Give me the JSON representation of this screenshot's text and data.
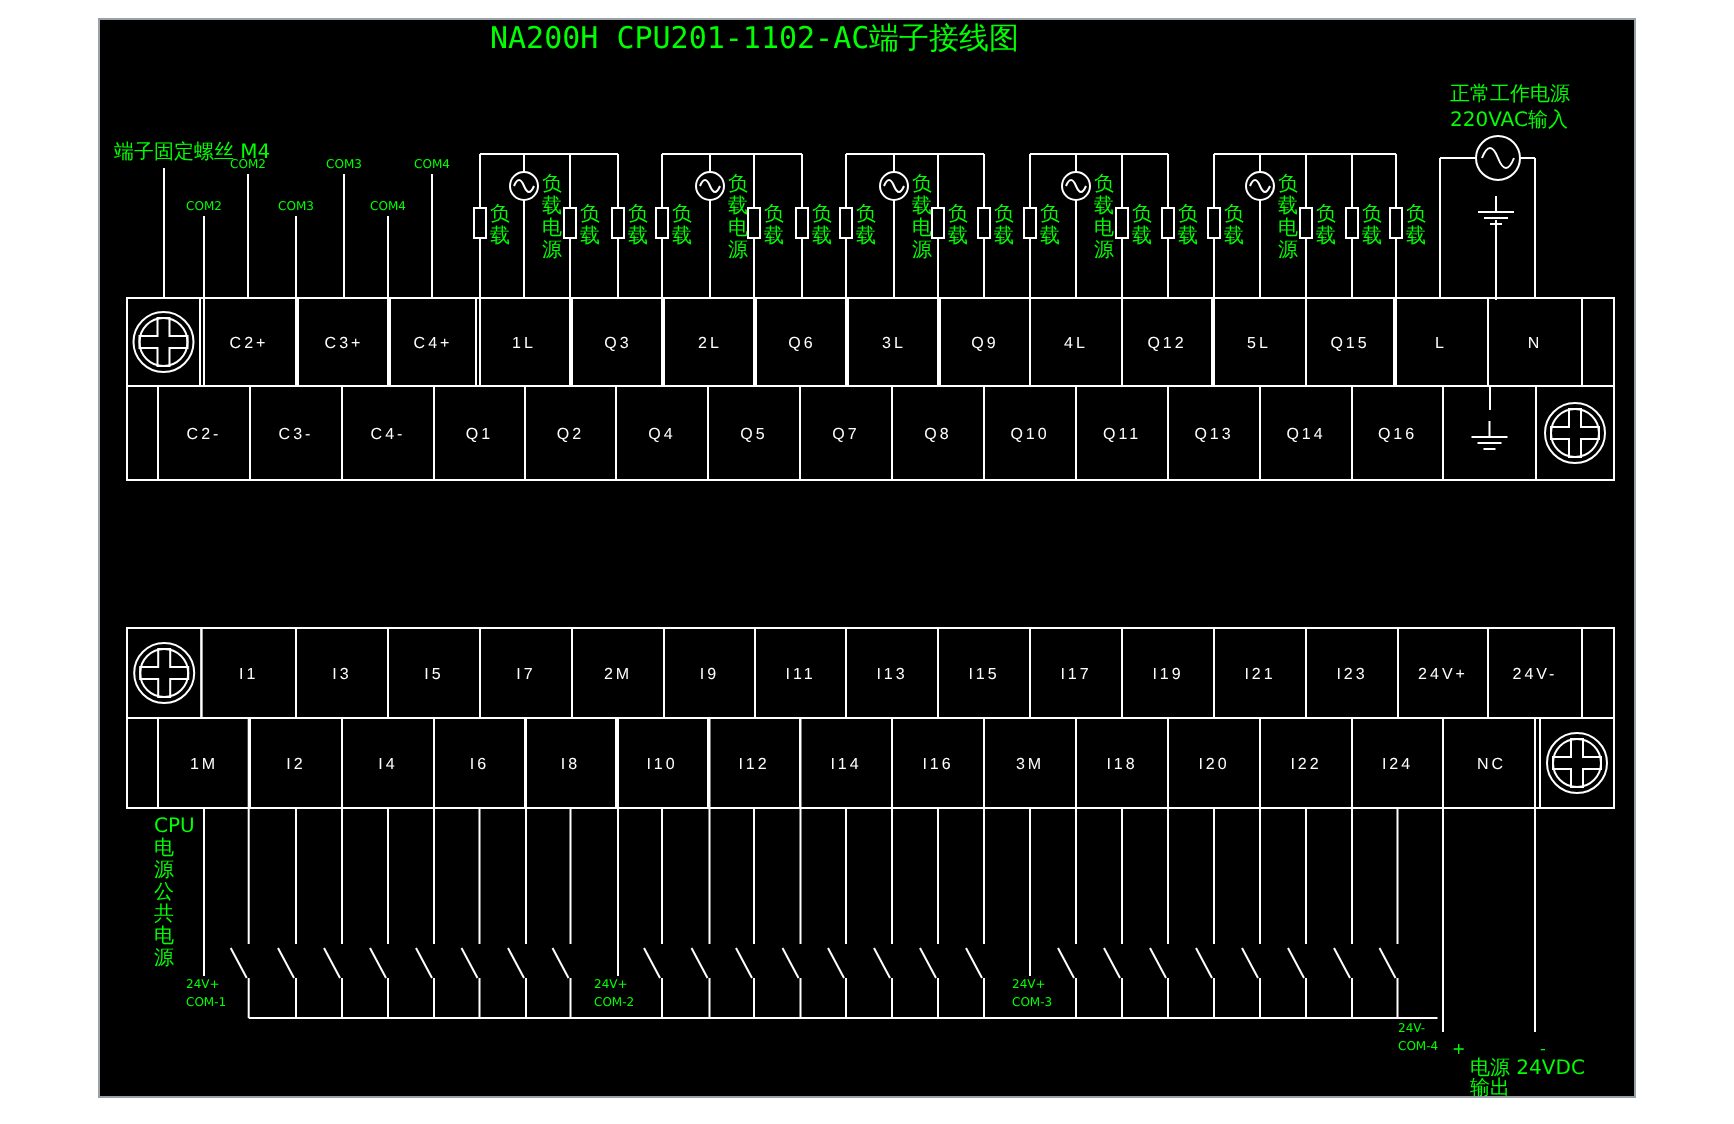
{
  "title": "NA200H CPU201-1102-AC端子接线图",
  "output_block": {
    "screw_note": "端子固定螺丝 M4",
    "com_labels": [
      {
        "text": "COM2",
        "kind": "lower"
      },
      {
        "text": "COM2",
        "kind": "upper"
      },
      {
        "text": "COM3",
        "kind": "lower"
      },
      {
        "text": "COM3",
        "kind": "upper"
      },
      {
        "text": "COM4",
        "kind": "lower"
      },
      {
        "text": "COM4",
        "kind": "upper"
      }
    ],
    "load_groups": [
      {
        "branches": [
          {
            "kind": "load",
            "label": "负载"
          },
          {
            "kind": "supply",
            "label": "负载电源"
          },
          {
            "kind": "load",
            "label": "负载"
          },
          {
            "kind": "load",
            "label": "负载"
          }
        ]
      },
      {
        "branches": [
          {
            "kind": "load",
            "label": "负载"
          },
          {
            "kind": "supply",
            "label": "负载电源"
          },
          {
            "kind": "load",
            "label": "负载"
          },
          {
            "kind": "load",
            "label": "负载"
          }
        ]
      },
      {
        "branches": [
          {
            "kind": "load",
            "label": "负载"
          },
          {
            "kind": "supply",
            "label": "负载电源"
          },
          {
            "kind": "load",
            "label": "负载"
          },
          {
            "kind": "load",
            "label": "负载"
          }
        ]
      },
      {
        "branches": [
          {
            "kind": "load",
            "label": "负载"
          },
          {
            "kind": "supply",
            "label": "负载电源"
          },
          {
            "kind": "load",
            "label": "负载"
          },
          {
            "kind": "load",
            "label": "负载"
          }
        ]
      },
      {
        "branches": [
          {
            "kind": "load",
            "label": "负载"
          },
          {
            "kind": "supply",
            "label": "负载电源"
          },
          {
            "kind": "load",
            "label": "负载"
          },
          {
            "kind": "load",
            "label": "负载"
          },
          {
            "kind": "load",
            "label": "负载"
          }
        ]
      }
    ],
    "power_note": [
      "正常工作电源",
      "220VAC输入"
    ],
    "top_row": [
      {
        "kind": "screw"
      },
      {
        "kind": "terminal",
        "label": "C2+"
      },
      {
        "kind": "terminal",
        "label": "C3+"
      },
      {
        "kind": "terminal",
        "label": "C4+"
      },
      {
        "kind": "terminal",
        "label": "1L"
      },
      {
        "kind": "terminal",
        "label": "Q3"
      },
      {
        "kind": "terminal",
        "label": "2L"
      },
      {
        "kind": "terminal",
        "label": "Q6"
      },
      {
        "kind": "terminal",
        "label": "3L"
      },
      {
        "kind": "terminal",
        "label": "Q9"
      },
      {
        "kind": "terminal",
        "label": "4L"
      },
      {
        "kind": "terminal",
        "label": "Q12"
      },
      {
        "kind": "terminal",
        "label": "5L"
      },
      {
        "kind": "terminal",
        "label": "Q15"
      },
      {
        "kind": "terminal",
        "label": "L"
      },
      {
        "kind": "terminal",
        "label": "N"
      },
      {
        "kind": "blank"
      }
    ],
    "bottom_row": [
      {
        "kind": "blank"
      },
      {
        "kind": "terminal",
        "label": "C2-"
      },
      {
        "kind": "terminal",
        "label": "C3-"
      },
      {
        "kind": "terminal",
        "label": "C4-"
      },
      {
        "kind": "terminal",
        "label": "Q1"
      },
      {
        "kind": "terminal",
        "label": "Q2"
      },
      {
        "kind": "terminal",
        "label": "Q4"
      },
      {
        "kind": "terminal",
        "label": "Q5"
      },
      {
        "kind": "terminal",
        "label": "Q7"
      },
      {
        "kind": "terminal",
        "label": "Q8"
      },
      {
        "kind": "terminal",
        "label": "Q10"
      },
      {
        "kind": "terminal",
        "label": "Q11"
      },
      {
        "kind": "terminal",
        "label": "Q13"
      },
      {
        "kind": "terminal",
        "label": "Q14"
      },
      {
        "kind": "terminal",
        "label": "Q16"
      },
      {
        "kind": "ground"
      },
      {
        "kind": "screw"
      }
    ]
  },
  "input_block": {
    "top_row": [
      {
        "kind": "screw"
      },
      {
        "kind": "input",
        "label": "I1"
      },
      {
        "kind": "input",
        "label": "I3"
      },
      {
        "kind": "input",
        "label": "I5"
      },
      {
        "kind": "input",
        "label": "I7"
      },
      {
        "kind": "common",
        "label": "2M"
      },
      {
        "kind": "input",
        "label": "I9"
      },
      {
        "kind": "input",
        "label": "I11"
      },
      {
        "kind": "input",
        "label": "I13"
      },
      {
        "kind": "input",
        "label": "I15"
      },
      {
        "kind": "input",
        "label": "I17"
      },
      {
        "kind": "input",
        "label": "I19"
      },
      {
        "kind": "input",
        "label": "I21"
      },
      {
        "kind": "input",
        "label": "I23"
      },
      {
        "kind": "power",
        "label": "24V+"
      },
      {
        "kind": "power",
        "label": "24V-"
      },
      {
        "kind": "blank"
      }
    ],
    "bottom_row": [
      {
        "kind": "blank"
      },
      {
        "kind": "common",
        "label": "1M"
      },
      {
        "kind": "input",
        "label": "I2"
      },
      {
        "kind": "input",
        "label": "I4"
      },
      {
        "kind": "input",
        "label": "I6"
      },
      {
        "kind": "input",
        "label": "I8"
      },
      {
        "kind": "input",
        "label": "I10"
      },
      {
        "kind": "input",
        "label": "I12"
      },
      {
        "kind": "input",
        "label": "I14"
      },
      {
        "kind": "input",
        "label": "I16"
      },
      {
        "kind": "common",
        "label": "3M"
      },
      {
        "kind": "input",
        "label": "I18"
      },
      {
        "kind": "input",
        "label": "I20"
      },
      {
        "kind": "input",
        "label": "I22"
      },
      {
        "kind": "input",
        "label": "I24"
      },
      {
        "kind": "terminal",
        "label": "NC"
      },
      {
        "kind": "screw"
      }
    ],
    "cpu_note": "CPU电源公共电源",
    "supply_labels": [
      {
        "line1": "24V+",
        "line2": "COM-1"
      },
      {
        "line1": "24V+",
        "line2": "COM-2"
      },
      {
        "line1": "24V+",
        "line2": "COM-3"
      },
      {
        "line1": "24V-",
        "line2": "COM-4"
      }
    ],
    "plus_sign": "+",
    "minus_sign": "-",
    "output_note": [
      "电源 24VDC",
      "输出"
    ]
  }
}
